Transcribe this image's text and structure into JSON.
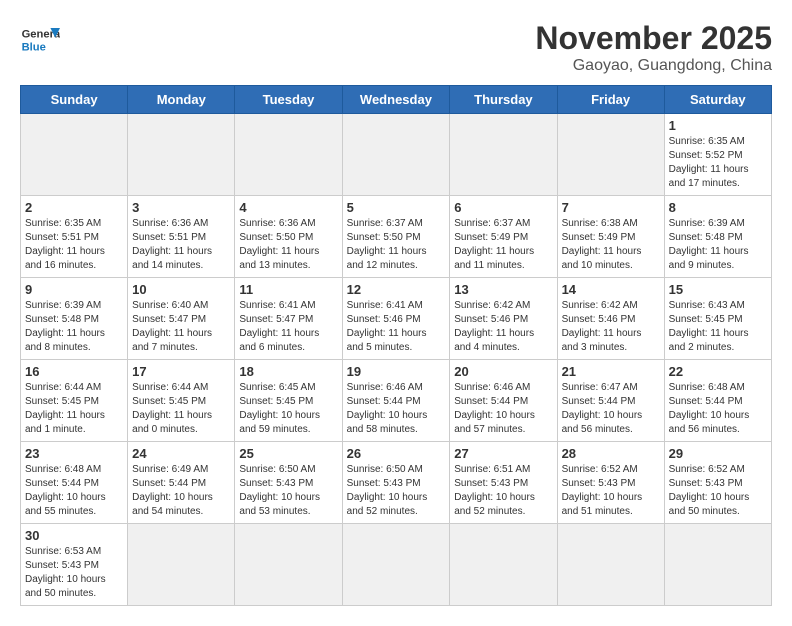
{
  "logo": {
    "general": "General",
    "blue": "Blue"
  },
  "header": {
    "month": "November 2025",
    "location": "Gaoyao, Guangdong, China"
  },
  "weekdays": [
    "Sunday",
    "Monday",
    "Tuesday",
    "Wednesday",
    "Thursday",
    "Friday",
    "Saturday"
  ],
  "days": [
    {
      "date": "",
      "info": ""
    },
    {
      "date": "",
      "info": ""
    },
    {
      "date": "",
      "info": ""
    },
    {
      "date": "",
      "info": ""
    },
    {
      "date": "",
      "info": ""
    },
    {
      "date": "",
      "info": ""
    },
    {
      "date": "1",
      "info": "Sunrise: 6:35 AM\nSunset: 5:52 PM\nDaylight: 11 hours and 17 minutes."
    },
    {
      "date": "2",
      "info": "Sunrise: 6:35 AM\nSunset: 5:51 PM\nDaylight: 11 hours and 16 minutes."
    },
    {
      "date": "3",
      "info": "Sunrise: 6:36 AM\nSunset: 5:51 PM\nDaylight: 11 hours and 14 minutes."
    },
    {
      "date": "4",
      "info": "Sunrise: 6:36 AM\nSunset: 5:50 PM\nDaylight: 11 hours and 13 minutes."
    },
    {
      "date": "5",
      "info": "Sunrise: 6:37 AM\nSunset: 5:50 PM\nDaylight: 11 hours and 12 minutes."
    },
    {
      "date": "6",
      "info": "Sunrise: 6:37 AM\nSunset: 5:49 PM\nDaylight: 11 hours and 11 minutes."
    },
    {
      "date": "7",
      "info": "Sunrise: 6:38 AM\nSunset: 5:49 PM\nDaylight: 11 hours and 10 minutes."
    },
    {
      "date": "8",
      "info": "Sunrise: 6:39 AM\nSunset: 5:48 PM\nDaylight: 11 hours and 9 minutes."
    },
    {
      "date": "9",
      "info": "Sunrise: 6:39 AM\nSunset: 5:48 PM\nDaylight: 11 hours and 8 minutes."
    },
    {
      "date": "10",
      "info": "Sunrise: 6:40 AM\nSunset: 5:47 PM\nDaylight: 11 hours and 7 minutes."
    },
    {
      "date": "11",
      "info": "Sunrise: 6:41 AM\nSunset: 5:47 PM\nDaylight: 11 hours and 6 minutes."
    },
    {
      "date": "12",
      "info": "Sunrise: 6:41 AM\nSunset: 5:46 PM\nDaylight: 11 hours and 5 minutes."
    },
    {
      "date": "13",
      "info": "Sunrise: 6:42 AM\nSunset: 5:46 PM\nDaylight: 11 hours and 4 minutes."
    },
    {
      "date": "14",
      "info": "Sunrise: 6:42 AM\nSunset: 5:46 PM\nDaylight: 11 hours and 3 minutes."
    },
    {
      "date": "15",
      "info": "Sunrise: 6:43 AM\nSunset: 5:45 PM\nDaylight: 11 hours and 2 minutes."
    },
    {
      "date": "16",
      "info": "Sunrise: 6:44 AM\nSunset: 5:45 PM\nDaylight: 11 hours and 1 minute."
    },
    {
      "date": "17",
      "info": "Sunrise: 6:44 AM\nSunset: 5:45 PM\nDaylight: 11 hours and 0 minutes."
    },
    {
      "date": "18",
      "info": "Sunrise: 6:45 AM\nSunset: 5:45 PM\nDaylight: 10 hours and 59 minutes."
    },
    {
      "date": "19",
      "info": "Sunrise: 6:46 AM\nSunset: 5:44 PM\nDaylight: 10 hours and 58 minutes."
    },
    {
      "date": "20",
      "info": "Sunrise: 6:46 AM\nSunset: 5:44 PM\nDaylight: 10 hours and 57 minutes."
    },
    {
      "date": "21",
      "info": "Sunrise: 6:47 AM\nSunset: 5:44 PM\nDaylight: 10 hours and 56 minutes."
    },
    {
      "date": "22",
      "info": "Sunrise: 6:48 AM\nSunset: 5:44 PM\nDaylight: 10 hours and 56 minutes."
    },
    {
      "date": "23",
      "info": "Sunrise: 6:48 AM\nSunset: 5:44 PM\nDaylight: 10 hours and 55 minutes."
    },
    {
      "date": "24",
      "info": "Sunrise: 6:49 AM\nSunset: 5:44 PM\nDaylight: 10 hours and 54 minutes."
    },
    {
      "date": "25",
      "info": "Sunrise: 6:50 AM\nSunset: 5:43 PM\nDaylight: 10 hours and 53 minutes."
    },
    {
      "date": "26",
      "info": "Sunrise: 6:50 AM\nSunset: 5:43 PM\nDaylight: 10 hours and 52 minutes."
    },
    {
      "date": "27",
      "info": "Sunrise: 6:51 AM\nSunset: 5:43 PM\nDaylight: 10 hours and 52 minutes."
    },
    {
      "date": "28",
      "info": "Sunrise: 6:52 AM\nSunset: 5:43 PM\nDaylight: 10 hours and 51 minutes."
    },
    {
      "date": "29",
      "info": "Sunrise: 6:52 AM\nSunset: 5:43 PM\nDaylight: 10 hours and 50 minutes."
    },
    {
      "date": "30",
      "info": "Sunrise: 6:53 AM\nSunset: 5:43 PM\nDaylight: 10 hours and 50 minutes."
    }
  ]
}
